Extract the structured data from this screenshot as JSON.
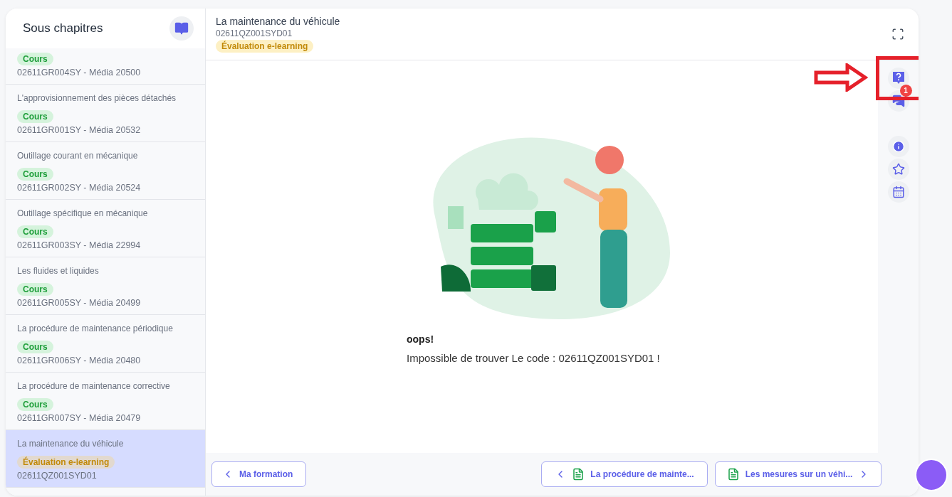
{
  "sidebar": {
    "title": "Sous chapitres",
    "items": [
      {
        "badge": {
          "kind": "course",
          "label": "Cours"
        },
        "code": "02611GR004SY - Média 20500",
        "selected": false
      },
      {
        "title": "L'approvisionnement des pièces détachés",
        "badge": {
          "kind": "course",
          "label": "Cours"
        },
        "code": "02611GR001SY - Média 20532",
        "selected": false
      },
      {
        "title": "Outillage courant en mécanique",
        "badge": {
          "kind": "course",
          "label": "Cours"
        },
        "code": "02611GR002SY - Média 20524",
        "selected": false
      },
      {
        "title": "Outillage spécifique en mécanique",
        "badge": {
          "kind": "course",
          "label": "Cours"
        },
        "code": "02611GR003SY - Média 22994",
        "selected": false
      },
      {
        "title": "Les fluides et liquides",
        "badge": {
          "kind": "course",
          "label": "Cours"
        },
        "code": "02611GR005SY - Média 20499",
        "selected": false
      },
      {
        "title": "La procédure de maintenance périodique",
        "badge": {
          "kind": "course",
          "label": "Cours"
        },
        "code": "02611GR006SY - Média 20480",
        "selected": false
      },
      {
        "title": "La procédure de maintenance corrective",
        "badge": {
          "kind": "course",
          "label": "Cours"
        },
        "code": "02611GR007SY - Média 20479",
        "selected": false
      },
      {
        "title": "La maintenance du véhicule",
        "badge": {
          "kind": "evaluation",
          "label": "Évaluation e-learning"
        },
        "code": "02611QZ001SYD01",
        "selected": true
      }
    ]
  },
  "header": {
    "title": "La maintenance du véhicule",
    "code": "02611QZ001SYD01",
    "badge": {
      "kind": "evaluation",
      "label": "Évaluation e-learning"
    }
  },
  "error": {
    "title": "oops!",
    "message": "Impossible de trouver Le code : 02611QZ001SYD01 !"
  },
  "rail": {
    "chat_badge": "1"
  },
  "footer": {
    "back": "Ma formation",
    "previous": "La procédure de mainte...",
    "next": "Les mesures sur un véhi..."
  }
}
